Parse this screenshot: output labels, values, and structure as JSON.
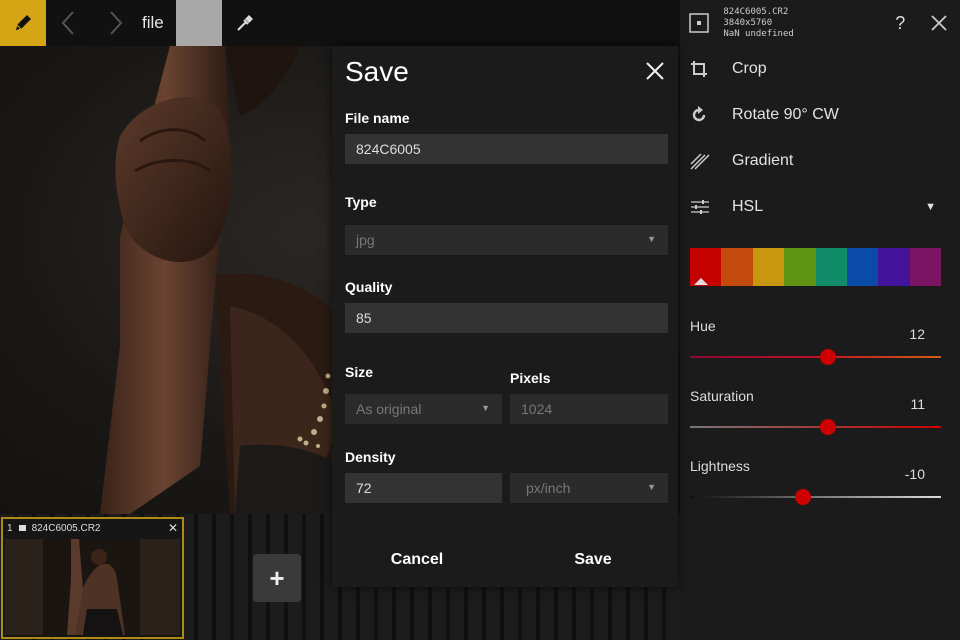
{
  "toolbar": {
    "file_label": "file",
    "tools": [
      "pencil-icon",
      "back-icon",
      "forward-icon",
      "eyedropper-icon"
    ],
    "active_color": "#d4a514",
    "swatch_color": "#a8a8a8"
  },
  "filmstrip": {
    "thumbnails": [
      {
        "index": "1",
        "name": "824C6005.CR2"
      }
    ],
    "add_label": "+"
  },
  "panel": {
    "file_info": [
      "824C6005.CR2",
      "3840x5760",
      "NaN undefined"
    ],
    "help_label": "?",
    "tools": [
      {
        "label": "Crop",
        "icon": "crop-icon"
      },
      {
        "label": "Rotate 90° CW",
        "icon": "rotate-icon"
      },
      {
        "label": "Gradient",
        "icon": "gradient-icon"
      },
      {
        "label": "HSL",
        "icon": "sliders-icon"
      }
    ],
    "hsl_colors": [
      "#c40000",
      "#c24a0c",
      "#c8960f",
      "#5e9411",
      "#0f8b67",
      "#0a4aa8",
      "#43149b",
      "#7a1463"
    ],
    "sliders": [
      {
        "name": "Hue",
        "value": "12",
        "fraction": 0.55
      },
      {
        "name": "Saturation",
        "value": "11",
        "fraction": 0.55
      },
      {
        "name": "Lightness",
        "value": "-10",
        "fraction": 0.45
      }
    ]
  },
  "dialog": {
    "title": "Save",
    "file_name_label": "File name",
    "file_name_value": "824C6005",
    "type_label": "Type",
    "type_value": "jpg",
    "quality_label": "Quality",
    "quality_value": "85",
    "size_label": "Size",
    "size_value": "As original",
    "pixels_label": "Pixels",
    "pixels_value": "1024",
    "density_label": "Density",
    "density_value": "72",
    "density_unit": "px/inch",
    "cancel_label": "Cancel",
    "save_label": "Save"
  }
}
